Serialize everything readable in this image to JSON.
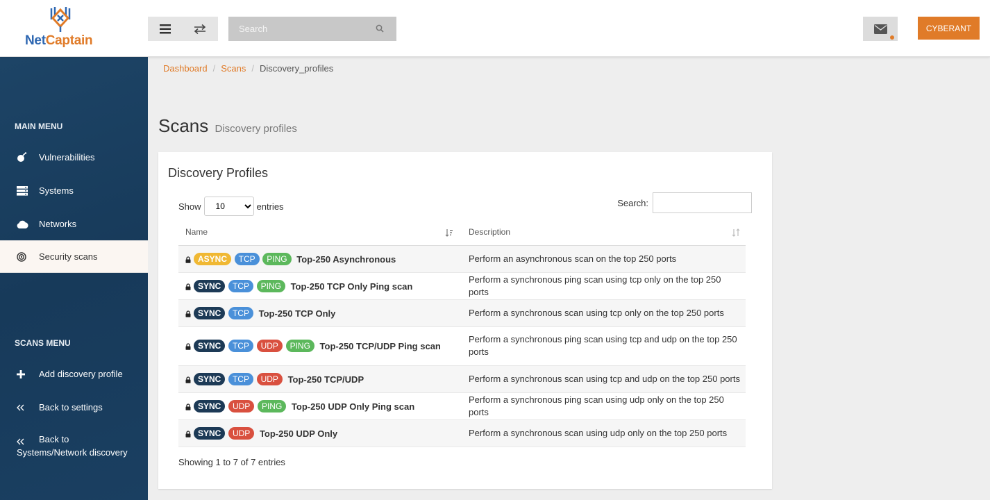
{
  "brand": {
    "name_part1": "Net",
    "name_part2": "Captain",
    "accent": "#e07b28",
    "blue": "#2e67b1"
  },
  "header": {
    "search_placeholder": "Search",
    "user_label": "CYBERANT"
  },
  "sidebar": {
    "main_menu_label": "MAIN MENU",
    "main_items": [
      {
        "label": "Vulnerabilities",
        "icon": "bomb-icon"
      },
      {
        "label": "Systems",
        "icon": "server-icon"
      },
      {
        "label": "Networks",
        "icon": "cloud-icon"
      },
      {
        "label": "Security scans",
        "icon": "target-icon",
        "active": true
      }
    ],
    "scans_menu_label": "SCANS MENU",
    "scans_items": [
      {
        "label": "Add discovery profile",
        "icon": "plus-icon"
      },
      {
        "label": "Back to settings",
        "icon": "double-chevron-left-icon"
      },
      {
        "label": "Back to Systems/Network discovery",
        "label_line1": "Back to",
        "label_line2": "Systems/Network discovery",
        "icon": "double-chevron-left-icon"
      }
    ]
  },
  "breadcrumb": [
    "Dashboard",
    "Scans",
    "Discovery_profiles"
  ],
  "page": {
    "title": "Scans",
    "subtitle": "Discovery profiles"
  },
  "card": {
    "title": "Discovery Profiles",
    "show_label": "Show",
    "entries_label": "entries",
    "page_size": "10",
    "search_label": "Search:",
    "columns": [
      "Name",
      "Description"
    ],
    "rows": [
      {
        "badges": [
          "ASYNC",
          "TCP",
          "PING"
        ],
        "name": "Top-250 Asynchronous",
        "description": "Perform an asynchronous scan on the top 250 ports"
      },
      {
        "badges": [
          "SYNC",
          "TCP",
          "PING"
        ],
        "name": "Top-250 TCP Only Ping scan",
        "description": "Perform a synchronous ping scan using tcp only on the top 250 ports"
      },
      {
        "badges": [
          "SYNC",
          "TCP"
        ],
        "name": "Top-250 TCP Only",
        "description": "Perform a synchronous scan using tcp only on the top 250 ports"
      },
      {
        "badges": [
          "SYNC",
          "TCP",
          "UDP",
          "PING"
        ],
        "name": "Top-250 TCP/UDP Ping scan",
        "description": "Perform a synchronous ping scan using tcp and udp on the top 250 ports"
      },
      {
        "badges": [
          "SYNC",
          "TCP",
          "UDP"
        ],
        "name": "Top-250 TCP/UDP",
        "description": "Perform a synchronous scan using tcp and udp on the top 250 ports"
      },
      {
        "badges": [
          "SYNC",
          "UDP",
          "PING"
        ],
        "name": "Top-250 UDP Only Ping scan",
        "description": "Perform a synchronous ping scan using udp only on the top 250 ports"
      },
      {
        "badges": [
          "SYNC",
          "UDP"
        ],
        "name": "Top-250 UDP Only",
        "description": "Perform a synchronous scan using udp only on the top 250 ports"
      }
    ],
    "info": "Showing 1 to 7 of 7 entries"
  }
}
